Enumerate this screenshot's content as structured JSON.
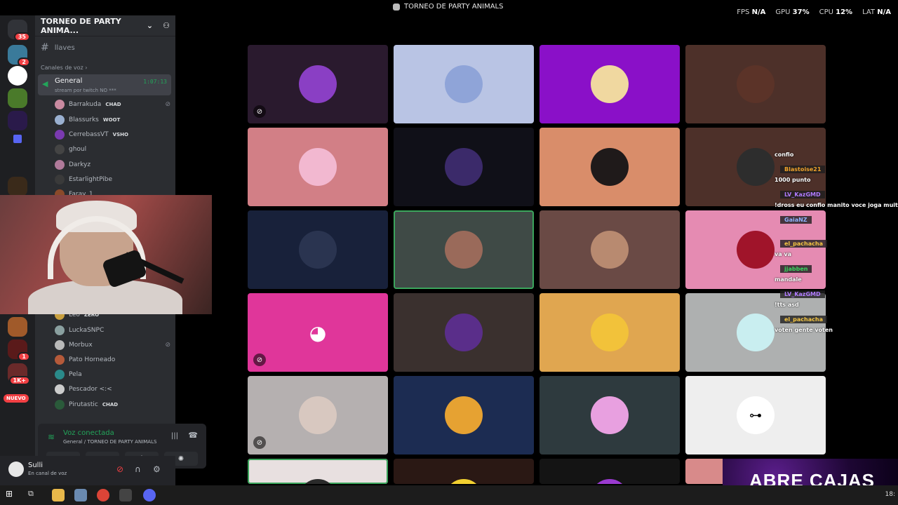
{
  "window": {
    "title": "TORNEO DE PARTY ANIMALS",
    "stats": [
      {
        "label": "FPS",
        "value": "N/A"
      },
      {
        "label": "GPU",
        "value": "37%"
      },
      {
        "label": "CPU",
        "value": "12%"
      },
      {
        "label": "LAT",
        "value": "N/A"
      }
    ]
  },
  "rail": {
    "home_badge": "35",
    "badges": [
      "2",
      "1",
      "1K+"
    ],
    "new_label": "NUEVO"
  },
  "sidebar": {
    "server_name": "TORNEO DE PARTY ANIMA...",
    "text_channel": "llaves",
    "category": "Canales de voz",
    "voice_channel": {
      "name": "General",
      "status": "stream por twitch NO ***",
      "timer": "1:07:13"
    },
    "users": [
      {
        "name": "Barrakuda",
        "tag": "CHAD",
        "muted": true
      },
      {
        "name": "Blassurks",
        "tag": "WOOT",
        "muted": false
      },
      {
        "name": "CerrebassVT",
        "tag": "VSHO",
        "muted": false
      },
      {
        "name": "ghoul",
        "tag": "",
        "muted": false
      },
      {
        "name": "Darkyz",
        "tag": "",
        "muted": false
      },
      {
        "name": "EstarlightPibe",
        "tag": "",
        "muted": false
      },
      {
        "name": "Faray_1",
        "tag": "",
        "muted": false
      },
      {
        "name": "Leo",
        "tag": "ZERO",
        "muted": false
      },
      {
        "name": "LuckaSNPC",
        "tag": "",
        "muted": false
      },
      {
        "name": "Morbux",
        "tag": "",
        "muted": true
      },
      {
        "name": "Pato Horneado",
        "tag": "",
        "muted": false
      },
      {
        "name": "Pela",
        "tag": "",
        "muted": false
      },
      {
        "name": "Pescador <:<",
        "tag": "",
        "muted": false
      },
      {
        "name": "Pirutastic",
        "tag": "CHAD",
        "muted": false
      }
    ]
  },
  "voice_panel": {
    "status": "Voz conectada",
    "location": "General / TORNEO DE PARTY ANIMALS"
  },
  "user_panel": {
    "name": "Sulli",
    "status": "En canal de voz"
  },
  "chat": [
    {
      "type": "msg",
      "text": "confio"
    },
    {
      "type": "name",
      "text": "Blastoise21",
      "color": "#f0a22a"
    },
    {
      "type": "msg",
      "text": "1000 punto"
    },
    {
      "type": "name",
      "text": "LV_KazGMD",
      "color": "#b07bff"
    },
    {
      "type": "msg",
      "text": "!dross eu confio manito voce joga muito"
    },
    {
      "type": "name",
      "text": "GaiaNZ",
      "color": "#8fb3ff"
    },
    {
      "type": "name",
      "text": "el_pachacha",
      "color": "#f4c542"
    },
    {
      "type": "msg",
      "text": "va va"
    },
    {
      "type": "name",
      "text": "jjabben",
      "color": "#37d65e"
    },
    {
      "type": "msg",
      "text": "mandale"
    },
    {
      "type": "name",
      "text": "LV_KazGMD",
      "color": "#b07bff"
    },
    {
      "type": "msg",
      "text": "!tts asd"
    },
    {
      "type": "name",
      "text": "el_pachacha",
      "color": "#f4c542"
    },
    {
      "type": "msg",
      "text": "voten gente voten"
    }
  ],
  "overlay_text": "ABRE CAJAS",
  "taskbar": {
    "clock": "18:"
  },
  "tiles": [
    {
      "bg": "#2a1a2e",
      "avatar": "#8a3fc4",
      "muted": true
    },
    {
      "bg": "#b9c4e4",
      "avatar": "#8fa4d8",
      "muted": false
    },
    {
      "bg": "#8a10c8",
      "avatar": "#f0d8a0",
      "muted": false
    },
    {
      "bg": "#4d3029",
      "avatar": "#5b3328",
      "muted": false
    },
    {
      "bg": "#d27f86",
      "avatar": "#f2b8d0",
      "muted": false
    },
    {
      "bg": "#101018",
      "avatar": "#3b2a6a",
      "muted": false
    },
    {
      "bg": "#d98d6a",
      "avatar": "#1f1a1a",
      "muted": false
    },
    {
      "bg": "#4d3029",
      "avatar": "#2d2d2d",
      "muted": false
    },
    {
      "bg": "#18213a",
      "avatar": "#2a3450",
      "muted": false
    },
    {
      "bg": "#3f4a46",
      "avatar": "#9a6a5a",
      "muted": false
    },
    {
      "bg": "#6a4a45",
      "avatar": "#b88a70",
      "muted": false
    },
    {
      "bg": "#e58bb2",
      "avatar": "#a0142a",
      "muted": false
    },
    {
      "bg": "#e0369a",
      "avatar": "#e0369a",
      "muted": true
    },
    {
      "bg": "#3a302e",
      "avatar": "#5a2e8a",
      "muted": false
    },
    {
      "bg": "#e0a650",
      "avatar": "#f2c23a",
      "muted": false
    },
    {
      "bg": "#aeb0b0",
      "avatar": "#c9eef0",
      "muted": false
    },
    {
      "bg": "#b5b0b0",
      "avatar": "#d8c8c0",
      "muted": true
    },
    {
      "bg": "#1c2c52",
      "avatar": "#e6a232",
      "muted": false
    },
    {
      "bg": "#2e3a3e",
      "avatar": "#e8a0e0",
      "muted": false
    },
    {
      "bg": "#eeeeee",
      "avatar": "#ffffff",
      "muted": false
    },
    {
      "bg": "#e8e0e0",
      "avatar": "#2a2a2a",
      "muted": false
    },
    {
      "bg": "#2a1814",
      "avatar": "#f2d030",
      "muted": false
    },
    {
      "bg": "#141414",
      "avatar": "#9a3ad0",
      "muted": false
    },
    {
      "bg": "#d88a8a",
      "avatar": "#c07070",
      "muted": false
    }
  ]
}
